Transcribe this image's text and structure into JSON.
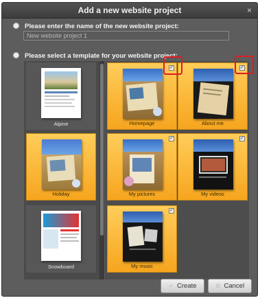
{
  "dialog": {
    "title": "Add a new website project",
    "close_glyph": "×"
  },
  "name_section": {
    "label": "Please enter the name of the new website project:",
    "input_value": "New website project 1"
  },
  "template_section": {
    "label": "Please select a template for your website project:"
  },
  "left_templates": [
    {
      "name": "Alpine"
    },
    {
      "name": "Holiday"
    },
    {
      "name": "Snowboard"
    }
  ],
  "grid_templates": [
    {
      "name": "Homepage",
      "checked": true,
      "icon": "homepage-template-thumbnail"
    },
    {
      "name": "About me",
      "checked": true,
      "icon": "about-me-template-thumbnail"
    },
    {
      "name": "My pictures",
      "checked": true,
      "icon": "pictures-template-thumbnail"
    },
    {
      "name": "My videos",
      "checked": true,
      "icon": "videos-template-thumbnail"
    },
    {
      "name": "My music",
      "checked": true,
      "icon": "music-template-thumbnail"
    }
  ],
  "buttons": {
    "create": "Create",
    "cancel": "Cancel"
  },
  "colors": {
    "selected_tile": "#f6a51e",
    "annotation": "#e11b22",
    "dialog_bg": "#5d5d5d"
  }
}
